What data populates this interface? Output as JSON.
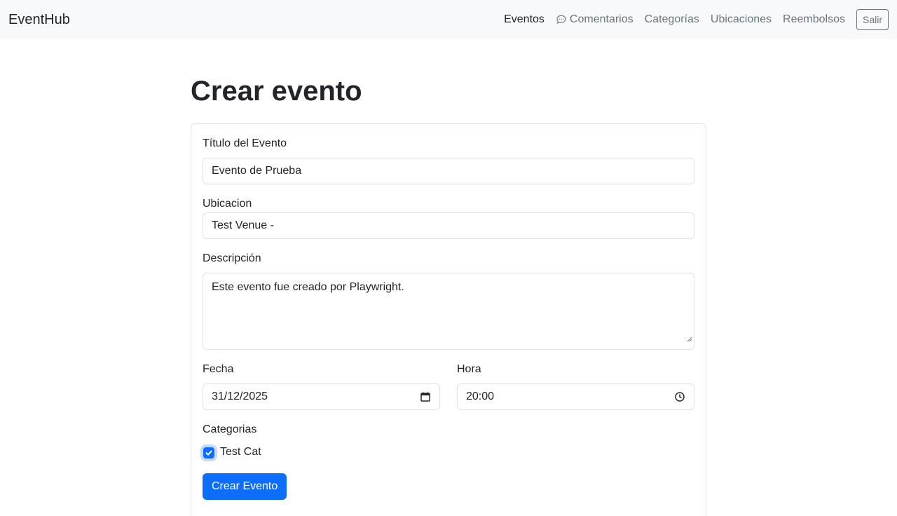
{
  "nav": {
    "brand": "EventHub",
    "items": [
      {
        "label": "Eventos",
        "active": true
      },
      {
        "label": "Comentarios",
        "icon": "chat-bubble-icon"
      },
      {
        "label": "Categorías"
      },
      {
        "label": "Ubicaciones"
      },
      {
        "label": "Reembolsos"
      }
    ],
    "logout_label": "Salir"
  },
  "page": {
    "title": "Crear evento"
  },
  "form": {
    "title_label": "Título del Evento",
    "title_value": "Evento de Prueba",
    "location_label": "Ubicacion",
    "location_value": "Test Venue -",
    "description_label": "Descripción",
    "description_value": "Este evento fue creado por Playwright.",
    "date_label": "Fecha",
    "date_value": "31/12/2025",
    "date_icon": "calendar-icon",
    "time_label": "Hora",
    "time_value": "20:00",
    "time_icon": "clock-icon",
    "categories_label": "Categorias",
    "categories": [
      {
        "label": "Test Cat",
        "checked": true
      }
    ],
    "submit_label": "Crear Evento"
  },
  "colors": {
    "primary": "#0d6efd",
    "navbar_bg": "#f8f9fa",
    "muted": "#6c757d",
    "border": "#dee2e6"
  }
}
